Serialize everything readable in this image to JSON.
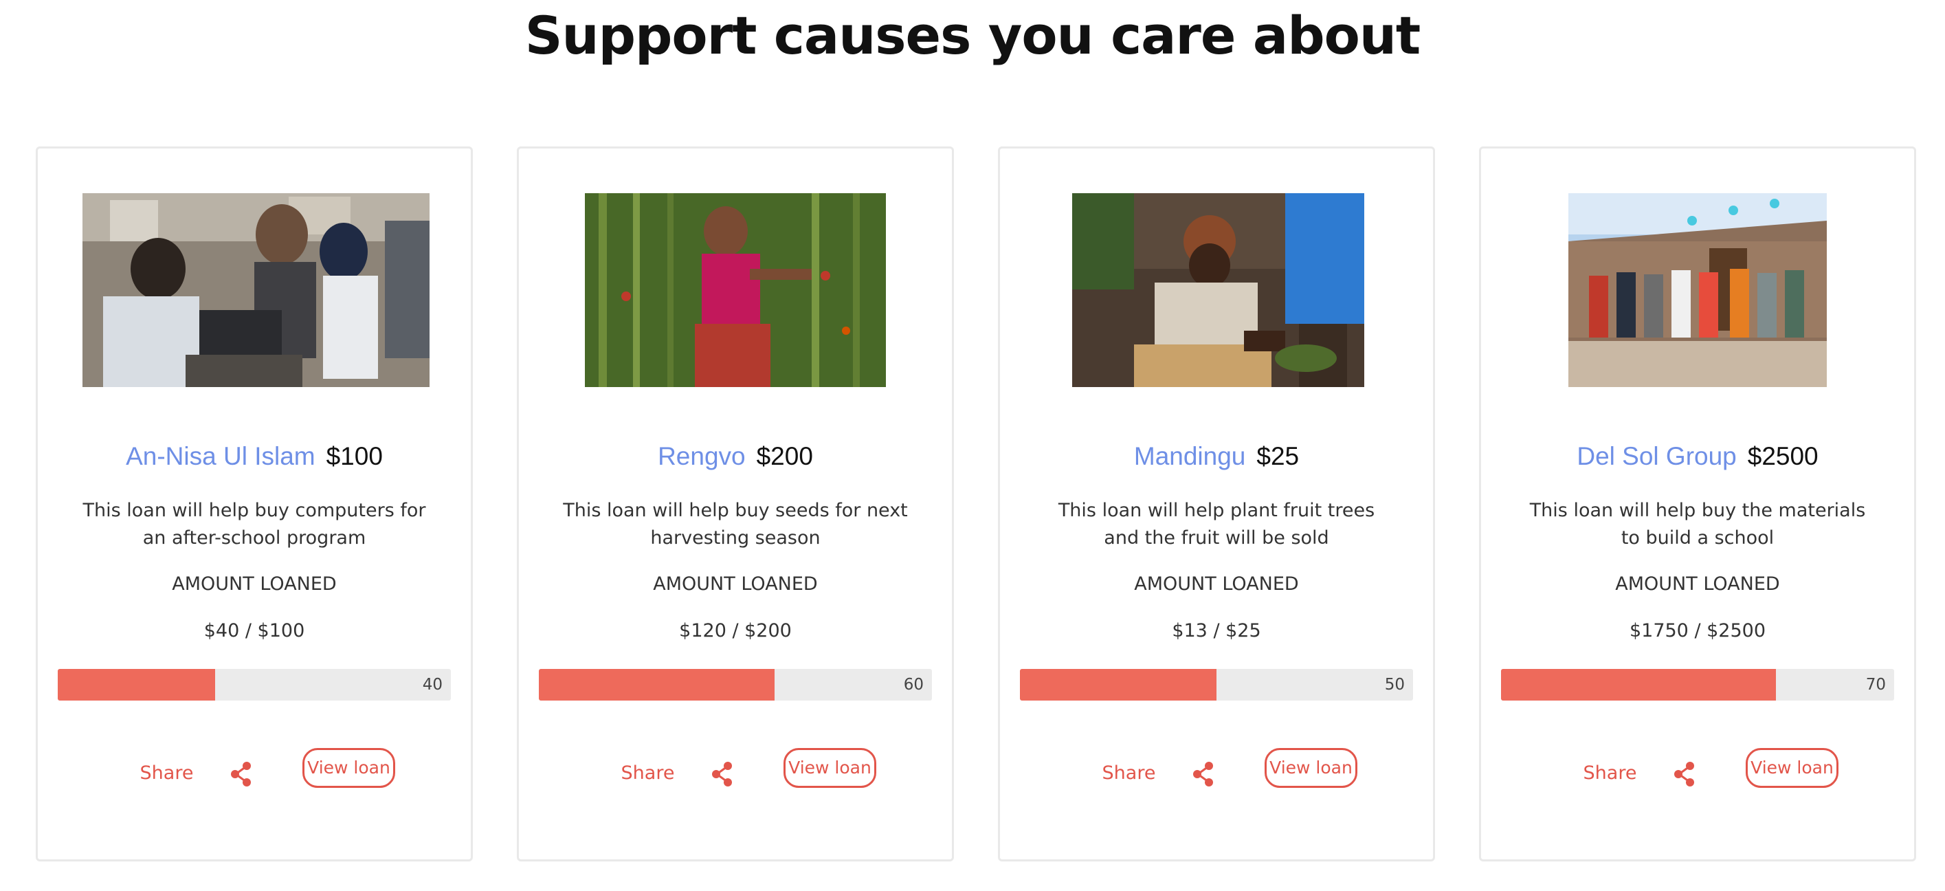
{
  "page": {
    "title": "Support causes you care about"
  },
  "colors": {
    "accent": "#e2554a",
    "progress_fill": "#ee6a5b",
    "progress_track": "#ebebeb",
    "name_link": "#6e8fe6"
  },
  "cards": [
    {
      "name": "An-Nisa Ul Islam",
      "goal": "$100",
      "description": "This loan will help buy computers for an after-school program",
      "amount_label": "AMOUNT LOANED",
      "amount_value": "$40 / $100",
      "progress": 40,
      "progress_label": "40",
      "share_label": "Share",
      "share_icon": "share-icon",
      "view_label": "View loan"
    },
    {
      "name": "Rengvo",
      "goal": "$200",
      "description": "This loan will help buy seeds for next harvesting season",
      "amount_label": "AMOUNT LOANED",
      "amount_value": "$120 / $200",
      "progress": 60,
      "progress_label": "60",
      "share_label": "Share",
      "share_icon": "share-icon",
      "view_label": "View loan"
    },
    {
      "name": "Mandingu",
      "goal": "$25",
      "description": "This loan will help plant fruit trees and the fruit will be sold",
      "amount_label": "AMOUNT LOANED",
      "amount_value": "$13 / $25",
      "progress": 50,
      "progress_label": "50",
      "share_label": "Share",
      "share_icon": "share-icon",
      "view_label": "View loan"
    },
    {
      "name": "Del Sol Group",
      "goal": "$2500",
      "description": "This loan will help buy the materials to build a school",
      "amount_label": "AMOUNT LOANED",
      "amount_value": "$1750 / $2500",
      "progress": 70,
      "progress_label": "70",
      "share_label": "Share",
      "share_icon": "share-icon",
      "view_label": "View loan"
    }
  ]
}
